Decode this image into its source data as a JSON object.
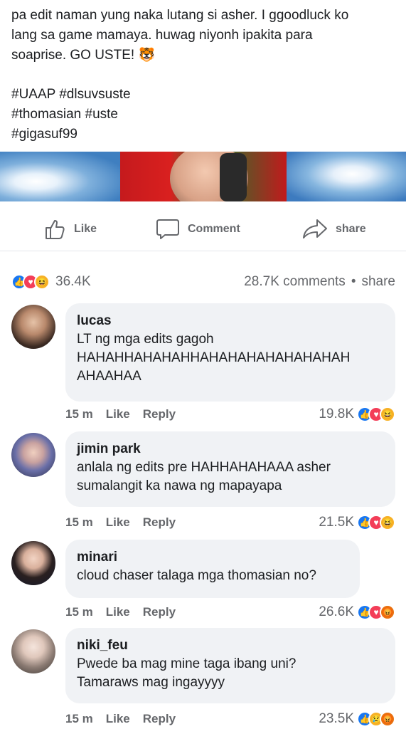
{
  "post": {
    "line1": "pa edit naman yung naka lutang si asher. I ggoodluck ko",
    "line2": "lang sa game mamaya. huwag niyonh ipakita para",
    "line3": "soaprise. GO USTE! 🐯",
    "hashtags1": "#UAAP #dlsuvsuste",
    "hashtags2": "#thomasian #uste",
    "hashtags3": "#gigasuf99"
  },
  "actions": {
    "like": "Like",
    "comment": "Comment",
    "share": "share"
  },
  "summary": {
    "reaction_count": "36.4K",
    "comments": "28.7K comments",
    "separator": "•",
    "share": "share"
  },
  "comments": [
    {
      "name": "lucas",
      "text1": "LT ng mga edits gagoh",
      "text2": "HAHAHHAHAHAHHAHAHAHAHAHAHAHAH",
      "text3": "AHAAHAA",
      "time": "15 m",
      "like": "Like",
      "reply": "Reply",
      "count": "19.8K"
    },
    {
      "name": "jimin park",
      "text1": "anlala ng edits pre HAHHAHAHAAA asher",
      "text2": "sumalangit ka nawa ng mapayapa",
      "time": "15 m",
      "like": "Like",
      "reply": "Reply",
      "count": "21.5K"
    },
    {
      "name": "minari",
      "text1": "cloud chaser talaga mga thomasian no?",
      "time": "15 m",
      "like": "Like",
      "reply": "Reply",
      "count": "26.6K"
    },
    {
      "name": "niki_feu",
      "text1": "Pwede ba mag mine taga ibang uni?",
      "text2": "Tamaraws mag ingayyyy",
      "time": "15 m",
      "like": "Like",
      "reply": "Reply",
      "count": "23.5K"
    }
  ],
  "colors": {
    "like_blue": "#1877f2",
    "love_red": "#f33e58",
    "haha_yellow": "#f7b125",
    "bubble_gray": "#f0f2f5",
    "meta_gray": "#65676b"
  }
}
